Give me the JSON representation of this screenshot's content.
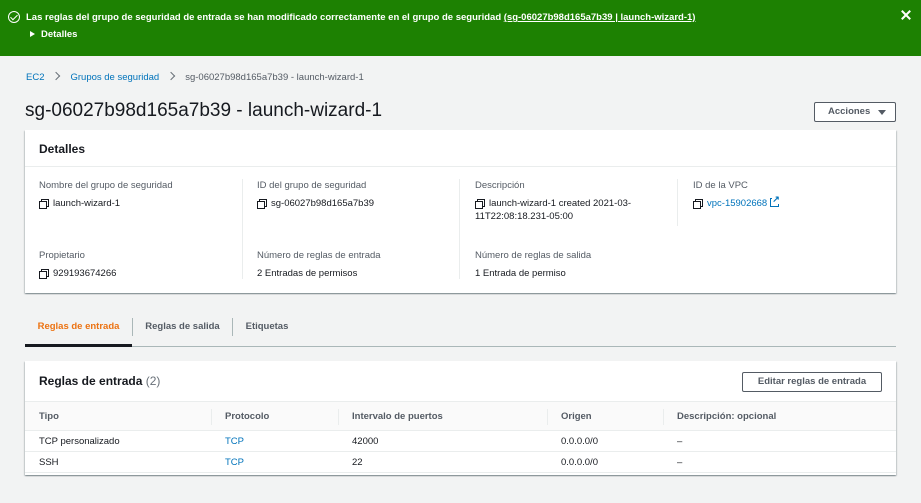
{
  "flash": {
    "message": "Las reglas del grupo de seguridad de entrada se han modificado correctamente en el grupo de seguridad ",
    "link": "(sg-06027b98d165a7b39 | launch-wizard-1)",
    "details": "Detalles"
  },
  "breadcrumb": {
    "items": [
      "EC2",
      "Grupos de seguridad"
    ],
    "current": "sg-06027b98d165a7b39 - launch-wizard-1"
  },
  "page": {
    "title": "sg-06027b98d165a7b39 - launch-wizard-1",
    "actions": "Acciones"
  },
  "details": {
    "header": "Detalles",
    "fields": [
      {
        "label": "Nombre del grupo de seguridad",
        "value": "launch-wizard-1"
      },
      {
        "label": "ID del grupo de seguridad",
        "value": "sg-06027b98d165a7b39"
      },
      {
        "label": "Descripción",
        "value": "launch-wizard-1 created 2021-03-11T22:08:18.231-05:00"
      },
      {
        "label": "ID de la VPC",
        "value": "vpc-15902668"
      },
      {
        "label": "Propietario",
        "value": "929193674266"
      },
      {
        "label": "Número de reglas de entrada",
        "value": "2 Entradas de permisos"
      },
      {
        "label": "Número de reglas de salida",
        "value": "1 Entrada de permiso"
      }
    ]
  },
  "tabs": [
    "Reglas de entrada",
    "Reglas de salida",
    "Etiquetas"
  ],
  "rules": {
    "title": "Reglas de entrada",
    "count": "(2)",
    "edit_button": "Editar reglas de entrada",
    "columns": [
      "Tipo",
      "Protocolo",
      "Intervalo de puertos",
      "Origen",
      "Descripción: opcional"
    ],
    "rows": [
      [
        "TCP personalizado",
        "TCP",
        "42000",
        "0.0.0.0/0",
        "–"
      ],
      [
        "SSH",
        "TCP",
        "22",
        "0.0.0.0/0",
        "–"
      ]
    ]
  },
  "colors": {
    "success": "#1d8102",
    "link": "#0073bb",
    "active_tab": "#ec7211"
  },
  "icons": [
    "check-circle-icon",
    "close-icon",
    "caret-right-icon",
    "caret-down-icon",
    "copy-icon",
    "external-link-icon"
  ]
}
